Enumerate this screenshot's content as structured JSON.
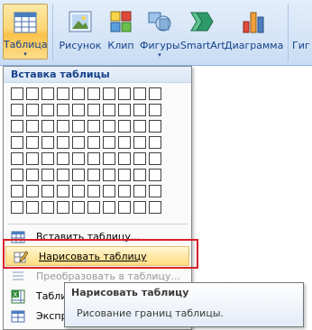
{
  "ribbon": {
    "table_label": "Таблица",
    "picture_label": "Рисунок",
    "clip_label": "Клип",
    "shapes_label": "Фигуры",
    "smartart_label": "SmartArt",
    "chart_label": "Диаграмма",
    "hyperlink_partial": "Гиг",
    "dropdown_arrow": "▾"
  },
  "dropdown": {
    "header": "Вставка таблицы",
    "grid": {
      "columns": 10,
      "rows": 8
    },
    "items": [
      {
        "label": "Вставить таблицу...",
        "state": "normal",
        "icon": "insert-table-icon"
      },
      {
        "label": "Нарисовать таблицу",
        "state": "highlighted",
        "icon": "pencil-icon"
      },
      {
        "label": "Преобразовать в таблицу...",
        "state": "disabled",
        "icon": "convert-text-icon"
      },
      {
        "label": "Таблица Excel",
        "state": "normal",
        "icon": "excel-table-icon"
      },
      {
        "label": "Экспресс-таблицы",
        "state": "normal",
        "icon": "quick-tables-icon"
      }
    ]
  },
  "tooltip": {
    "title": "Нарисовать таблицу",
    "description": "Рисование границ таблицы."
  },
  "colors": {
    "accent": "#15428b",
    "highlight": "#ffe8a6",
    "annotation": "#d8202a"
  }
}
